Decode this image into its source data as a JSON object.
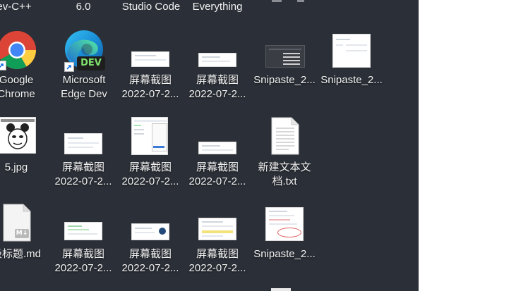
{
  "top_labels": {
    "c0": "ev-C++",
    "c1": "6.0",
    "c2": "Studio Code",
    "c3": "Everything"
  },
  "row1": {
    "chrome": {
      "line1": "Google",
      "line2": "Chrome"
    },
    "edge": {
      "line1": "Microsoft",
      "line2": "Edge Dev",
      "badge": "DEV"
    },
    "shot1": {
      "line1": "屏幕截图",
      "line2": "2022-07-2..."
    },
    "shot2": {
      "line1": "屏幕截图",
      "line2": "2022-07-2..."
    },
    "snip1": {
      "line1": "Snipaste_2..."
    },
    "snip2": {
      "line1": "Snipaste_2..."
    }
  },
  "row2": {
    "jpg": {
      "line1": "5.jpg"
    },
    "shot3": {
      "line1": "屏幕截图",
      "line2": "2022-07-2..."
    },
    "shot4": {
      "line1": "屏幕截图",
      "line2": "2022-07-2..."
    },
    "shot5": {
      "line1": "屏幕截图",
      "line2": "2022-07-2..."
    },
    "txt": {
      "line1": "新建文本文",
      "line2": "档.txt"
    }
  },
  "row3": {
    "md": {
      "line1": "级标题.md",
      "badge": "M↓"
    },
    "shot6": {
      "line1": "屏幕截图",
      "line2": "2022-07-2..."
    },
    "shot7": {
      "line1": "屏幕截图",
      "line2": "2022-07-2..."
    },
    "shot8": {
      "line1": "屏幕截图",
      "line2": "2022-07-2..."
    },
    "snip3": {
      "line1": "Snipaste_2..."
    }
  },
  "colors": {
    "desktop_bg": "#2b2f37",
    "label_text": "#f2f2f2",
    "edge_badge": "#1e1e1e",
    "edge_badge_text": "#7fe36b"
  }
}
